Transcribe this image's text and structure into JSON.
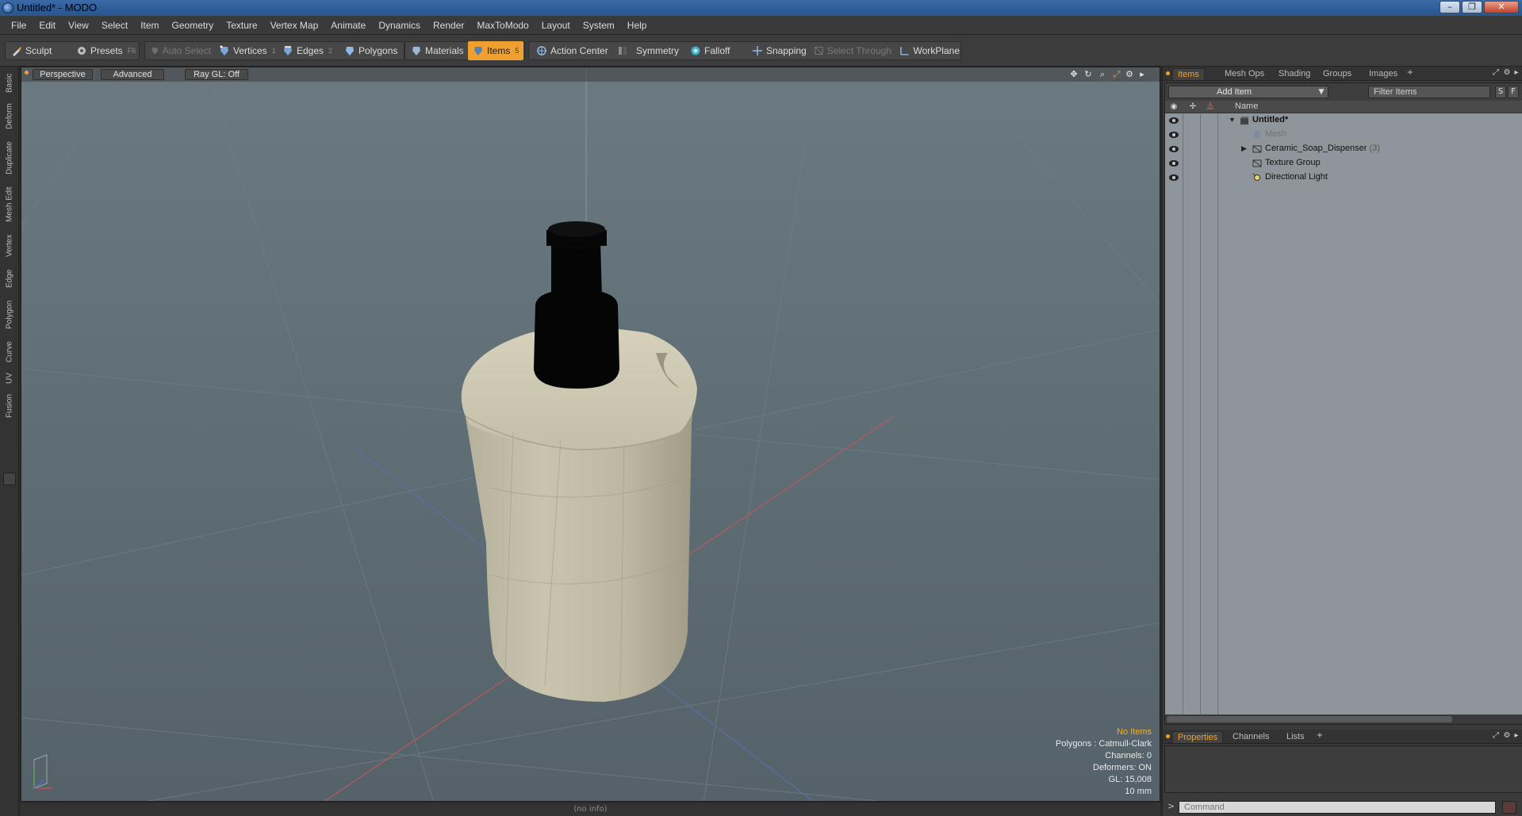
{
  "window": {
    "title": "Untitled* - MODO",
    "buttons": [
      "–",
      "❐",
      "✕"
    ]
  },
  "menubar": [
    "File",
    "Edit",
    "View",
    "Select",
    "Item",
    "Geometry",
    "Texture",
    "Vertex Map",
    "Animate",
    "Dynamics",
    "Render",
    "MaxToModo",
    "Layout",
    "System",
    "Help"
  ],
  "toolbar": {
    "sculpt": "Sculpt",
    "presets": "Presets",
    "presets_key": "F6",
    "auto_select": "Auto Select",
    "vertices": "Vertices",
    "vertices_key": "1",
    "edges": "Edges",
    "edges_key": "2",
    "polygons": "Polygons",
    "materials": "Materials",
    "items": "Items",
    "items_key": "5",
    "action_center": "Action Center",
    "symmetry": "Symmetry",
    "falloff": "Falloff",
    "snapping": "Snapping",
    "select_through": "Select Through",
    "workplane": "WorkPlane",
    "accent_color": "#f0a030"
  },
  "left_tabs": [
    "Basic",
    "Deform",
    "Duplicate",
    "Mesh Edit",
    "Vertex",
    "Edge",
    "Polygon",
    "Curve",
    "UV",
    "Fusion"
  ],
  "viewport": {
    "view_mode": "Perspective",
    "shading": "Advanced",
    "raygl": "Ray GL: Off",
    "info": {
      "selection": "No Items",
      "polygons": "Polygons : Catmull-Clark",
      "channels": "Channels: 0",
      "deformers": "Deformers: ON",
      "gl": "GL: 15,008",
      "grid": "10 mm"
    },
    "status": "(no info)"
  },
  "items_panel": {
    "tabs": [
      "Items",
      "Mesh Ops",
      "Shading",
      "Groups",
      "Images"
    ],
    "add_item": "Add Item",
    "filter_placeholder": "Filter Items",
    "btn_s": "S",
    "btn_f": "F",
    "column_name": "Name",
    "tree": [
      {
        "label": "Untitled*",
        "kind": "scene",
        "bold": true
      },
      {
        "label": "Mesh",
        "kind": "mesh",
        "dimmed": true
      },
      {
        "label": "Ceramic_Soap_Dispenser",
        "count": "(3)",
        "kind": "group"
      },
      {
        "label": "Texture Group",
        "kind": "group"
      },
      {
        "label": "Directional Light",
        "kind": "light"
      }
    ]
  },
  "properties_panel": {
    "tabs": [
      "Properties",
      "Channels",
      "Lists"
    ]
  },
  "command": {
    "prompt": ">",
    "placeholder": "Command"
  }
}
